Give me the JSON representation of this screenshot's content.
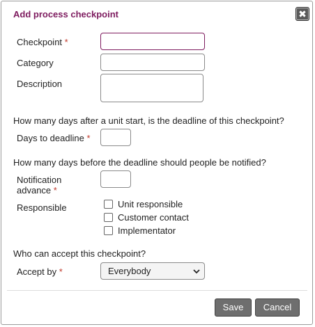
{
  "dialog": {
    "title": "Add process checkpoint",
    "close_symbol": "✖"
  },
  "fields": {
    "checkpoint": {
      "label": "Checkpoint",
      "required_mark": "*",
      "value": ""
    },
    "category": {
      "label": "Category",
      "value": ""
    },
    "description": {
      "label": "Description",
      "value": ""
    },
    "deadline_question": "How many days after a unit start, is the deadline of this checkpoint?",
    "days_to_deadline": {
      "label": "Days to deadline",
      "required_mark": "*",
      "value": ""
    },
    "notify_question": "How many days before the deadline should people be notified?",
    "notification_advance": {
      "label_line1": "Notification",
      "label_line2": "advance",
      "required_mark": "*",
      "value": ""
    },
    "responsible": {
      "label": "Responsible",
      "options": [
        {
          "label": "Unit responsible",
          "checked": false
        },
        {
          "label": "Customer contact",
          "checked": false
        },
        {
          "label": "Implementator",
          "checked": false
        }
      ]
    },
    "accept_question": "Who can accept this checkpoint?",
    "accept_by": {
      "label": "Accept by",
      "required_mark": "*",
      "selected": "Everybody"
    }
  },
  "buttons": {
    "save": "Save",
    "cancel": "Cancel"
  },
  "colors": {
    "title": "#7d1a5e",
    "required": "#c0392b",
    "button_bg": "#6e6e6e",
    "focus_border": "#7d1a5e"
  }
}
